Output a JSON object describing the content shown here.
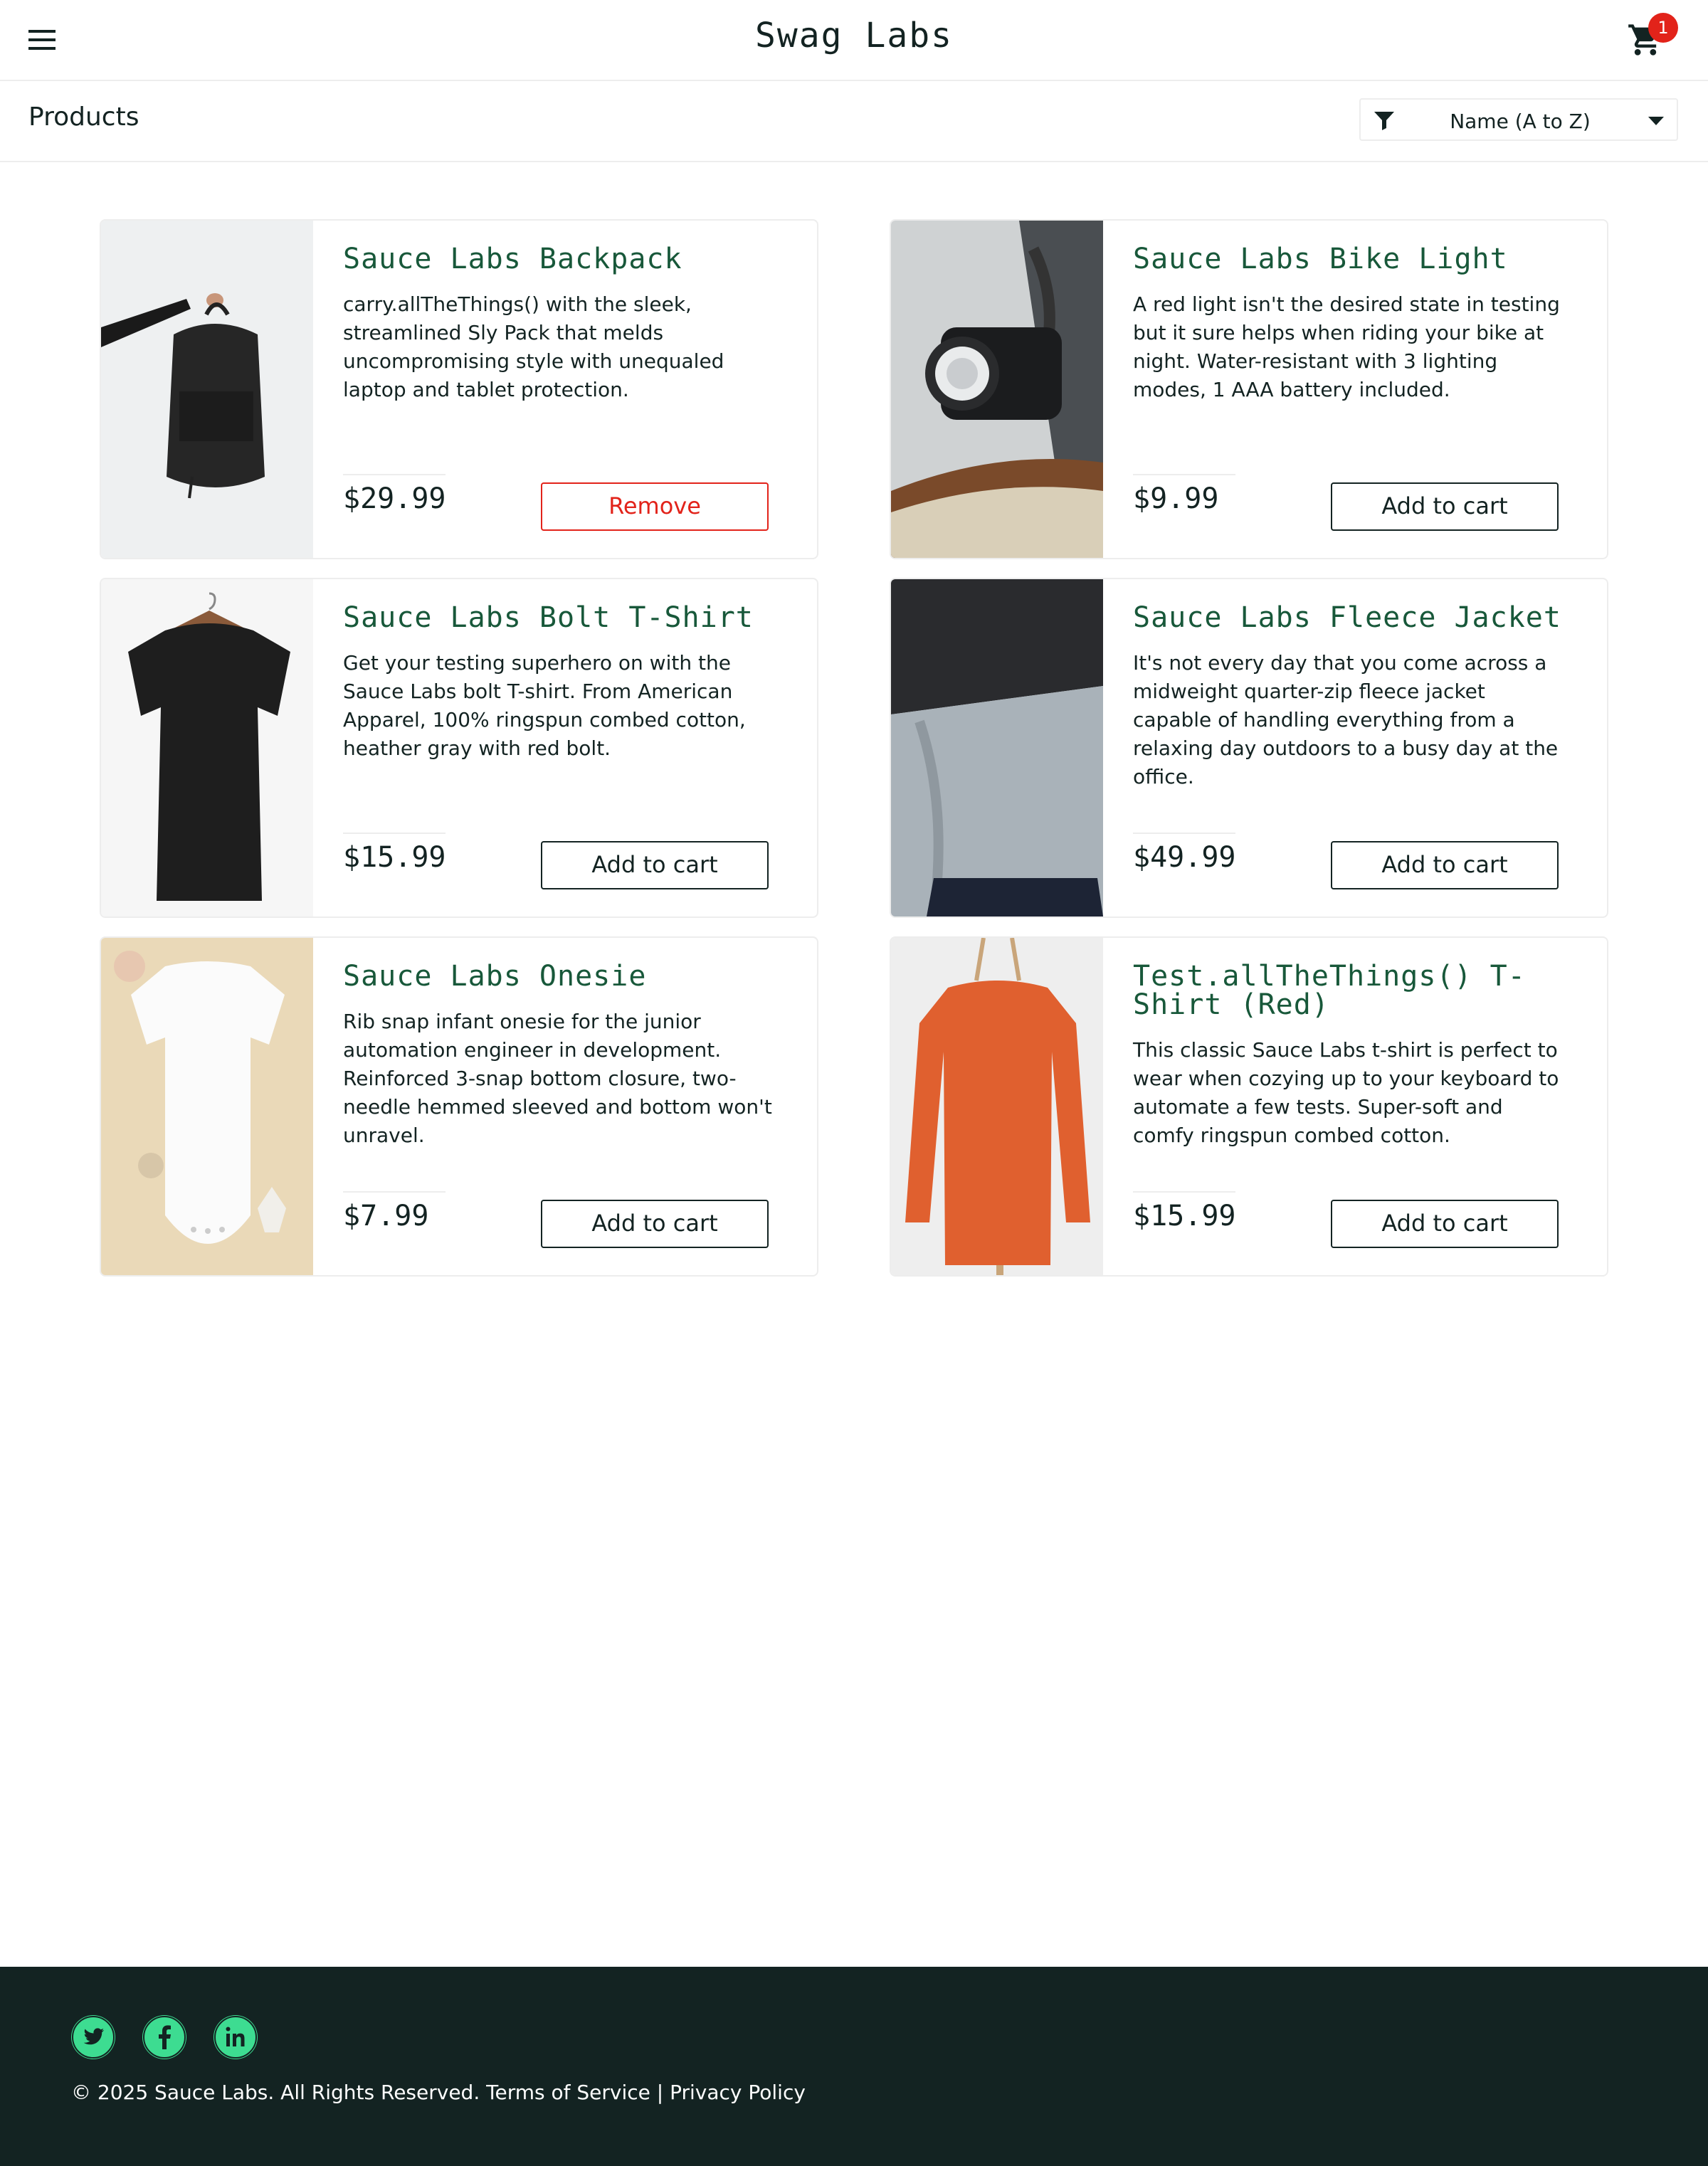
{
  "header": {
    "logo": "Swag Labs",
    "menu_icon": "hamburger-menu-icon",
    "cart_icon": "shopping-cart-icon",
    "cart_count": "1"
  },
  "subheader": {
    "title": "Products",
    "filter_icon": "filter-icon",
    "sort_selected": "Name (A to Z)",
    "caret_icon": "caret-down-icon"
  },
  "products": [
    {
      "name": "Sauce Labs Backpack",
      "description": "carry.allTheThings() with the sleek, streamlined Sly Pack that melds uncompromising style with unequaled laptop and tablet protection.",
      "price": "$29.99",
      "button": "Remove"
    },
    {
      "name": "Sauce Labs Bike Light",
      "description": "A red light isn't the desired state in testing but it sure helps when riding your bike at night. Water-resistant with 3 lighting modes, 1 AAA battery included.",
      "price": "$9.99",
      "button": "Add to cart"
    },
    {
      "name": "Sauce Labs Bolt T-Shirt",
      "description": "Get your testing superhero on with the Sauce Labs bolt T-shirt. From American Apparel, 100% ringspun combed cotton, heather gray with red bolt.",
      "price": "$15.99",
      "button": "Add to cart"
    },
    {
      "name": "Sauce Labs Fleece Jacket",
      "description": "It's not every day that you come across a midweight quarter-zip fleece jacket capable of handling everything from a relaxing day outdoors to a busy day at the office.",
      "price": "$49.99",
      "button": "Add to cart"
    },
    {
      "name": "Sauce Labs Onesie",
      "description": "Rib snap infant onesie for the junior automation engineer in development. Reinforced 3-snap bottom closure, two-needle hemmed sleeved and bottom won't unravel.",
      "price": "$7.99",
      "button": "Add to cart"
    },
    {
      "name": "Test.allTheThings() T-Shirt (Red)",
      "description": "This classic Sauce Labs t-shirt is perfect to wear when cozying up to your keyboard to automate a few tests. Super-soft and comfy ringspun combed cotton.",
      "price": "$15.99",
      "button": "Add to cart"
    }
  ],
  "footer": {
    "social": [
      "twitter-icon",
      "facebook-icon",
      "linkedin-icon"
    ],
    "copyright": "© 2025 Sauce Labs. All Rights Reserved. Terms of Service | Privacy Policy"
  },
  "colors": {
    "accent_green": "#18583a",
    "remove_red": "#e2231a",
    "footer_bg": "#132322",
    "social_green": "#3ddc91"
  }
}
